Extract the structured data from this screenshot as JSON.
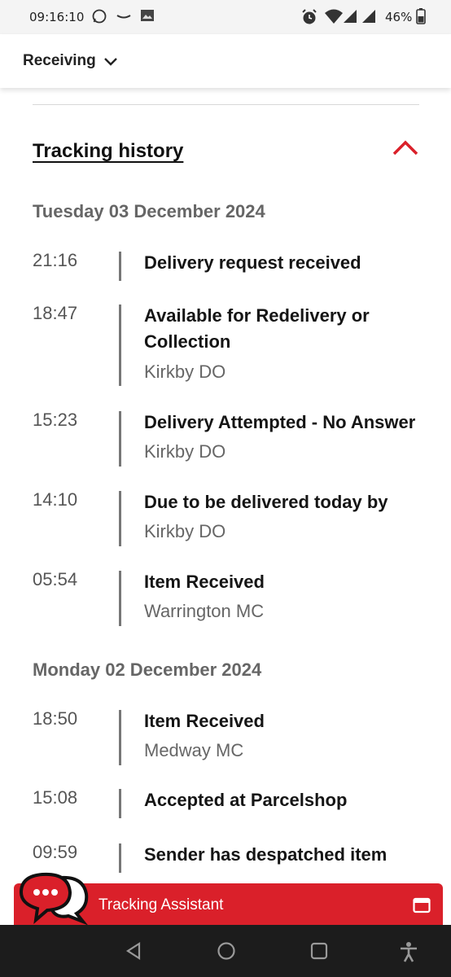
{
  "status_bar": {
    "time": "09:16:10",
    "battery": "46%"
  },
  "header": {
    "title": "Receiving"
  },
  "section": {
    "title": "Tracking history"
  },
  "days": [
    {
      "date": "Tuesday 03 December 2024",
      "events": [
        {
          "time": "21:16",
          "title": "Delivery request received",
          "location": ""
        },
        {
          "time": "18:47",
          "title": "Available for Redelivery or Collection",
          "location": "Kirkby DO"
        },
        {
          "time": "15:23",
          "title": "Delivery Attempted - No Answer",
          "location": "Kirkby DO"
        },
        {
          "time": "14:10",
          "title": "Due to be delivered today by",
          "location": "Kirkby DO"
        },
        {
          "time": "05:54",
          "title": "Item Received",
          "location": "Warrington MC"
        }
      ]
    },
    {
      "date": "Monday 02 December 2024",
      "events": [
        {
          "time": "18:50",
          "title": "Item Received",
          "location": "Medway MC"
        },
        {
          "time": "15:08",
          "title": "Accepted at Parcelshop",
          "location": ""
        },
        {
          "time": "09:59",
          "title": "Sender has despatched item",
          "location": ""
        }
      ]
    }
  ],
  "assistant": {
    "label": "Tracking Assistant"
  },
  "colors": {
    "brand_red": "#da202a",
    "nav_bg": "#1c1c1c"
  }
}
